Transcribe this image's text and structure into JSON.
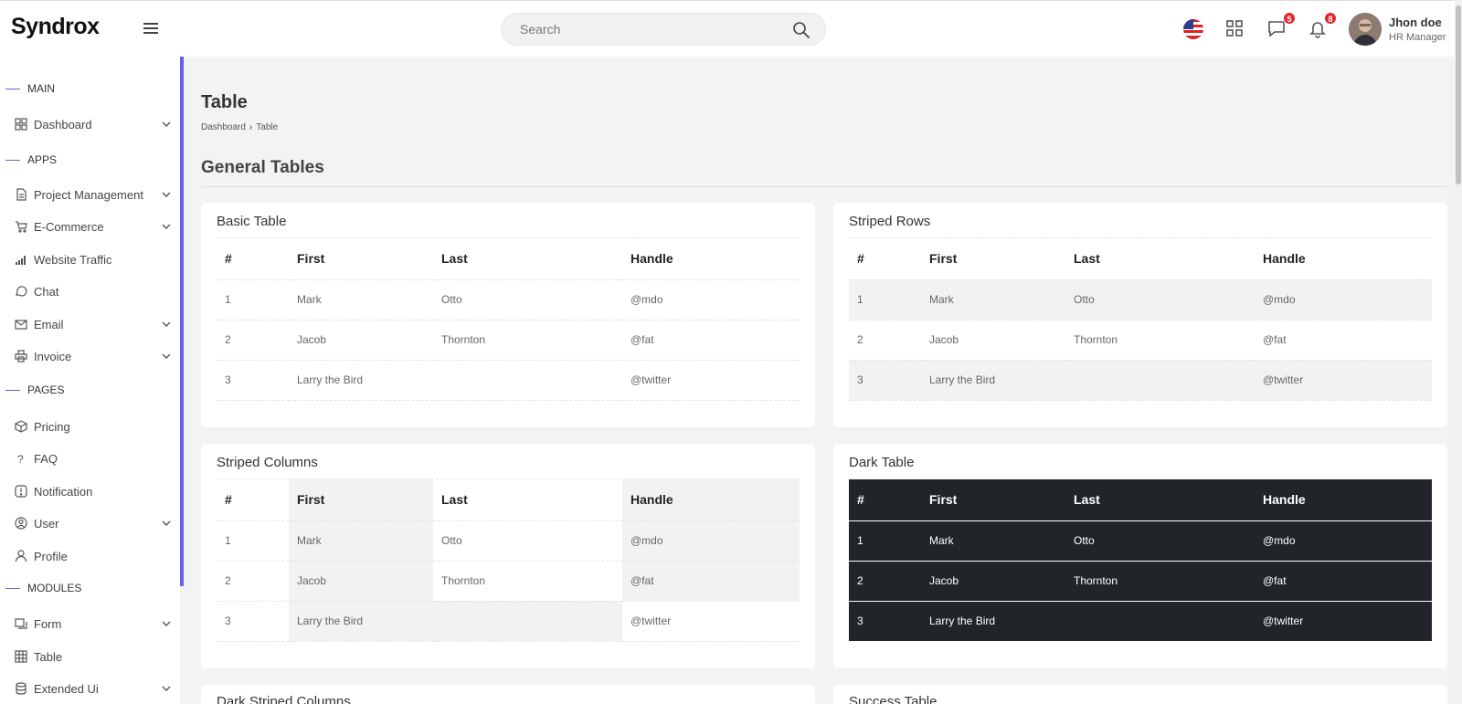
{
  "app": {
    "logo": "Syndrox"
  },
  "search": {
    "placeholder": "Search"
  },
  "header": {
    "messages_badge": "5",
    "notifications_badge": "8",
    "user_name": "Jhon doe",
    "user_role": "HR Manager"
  },
  "sidebar": {
    "sections": {
      "main": "MAIN",
      "apps": "APPS",
      "pages": "PAGES",
      "modules": "MODULES"
    },
    "items": [
      {
        "label": "Dashboard",
        "icon": "grid-icon",
        "has_chevron": true
      },
      {
        "label": "Project Management",
        "icon": "document-icon",
        "has_chevron": true
      },
      {
        "label": "E-Commerce",
        "icon": "cart-icon",
        "has_chevron": true
      },
      {
        "label": "Website Traffic",
        "icon": "signal-icon",
        "has_chevron": false
      },
      {
        "label": "Chat",
        "icon": "chat-icon",
        "has_chevron": false
      },
      {
        "label": "Email",
        "icon": "mail-icon",
        "has_chevron": true
      },
      {
        "label": "Invoice",
        "icon": "printer-icon",
        "has_chevron": true
      },
      {
        "label": "Pricing",
        "icon": "box-icon",
        "has_chevron": false
      },
      {
        "label": "FAQ",
        "icon": "question-icon",
        "has_chevron": false
      },
      {
        "label": "Notification",
        "icon": "alert-icon",
        "has_chevron": false
      },
      {
        "label": "User",
        "icon": "user-circle-icon",
        "has_chevron": true
      },
      {
        "label": "Profile",
        "icon": "person-icon",
        "has_chevron": false
      },
      {
        "label": "Form",
        "icon": "form-icon",
        "has_chevron": true
      },
      {
        "label": "Table",
        "icon": "table-icon",
        "has_chevron": false
      },
      {
        "label": "Extended Ui",
        "icon": "database-icon",
        "has_chevron": true
      }
    ]
  },
  "page": {
    "title": "Table",
    "breadcrumb": [
      "Dashboard",
      "Table"
    ],
    "section_title": "General Tables"
  },
  "tables": {
    "headers": [
      "#",
      "First",
      "Last",
      "Handle"
    ],
    "rows": [
      [
        "1",
        "Mark",
        "Otto",
        "@mdo"
      ],
      [
        "2",
        "Jacob",
        "Thornton",
        "@fat"
      ],
      [
        "3",
        "Larry the Bird",
        "",
        "@twitter"
      ]
    ],
    "basic_title": "Basic Table",
    "striped_rows_title": "Striped Rows",
    "striped_columns_title": "Striped Columns",
    "dark_title": "Dark Table",
    "dark_striped_title": "Dark Striped Columns",
    "success_title": "Success Table"
  },
  "colors": {
    "accent": "#6a5fe8",
    "badge": "#e3262f",
    "dark_table": "#212529",
    "stripe": "#f2f2f2"
  }
}
